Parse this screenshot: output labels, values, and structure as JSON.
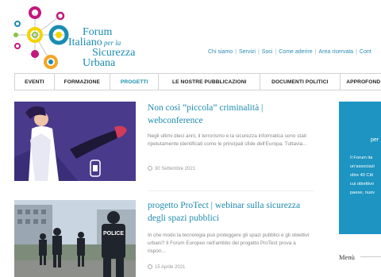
{
  "brand": {
    "line1": "Forum",
    "line2_main": "Italiano",
    "line2_small": " per la",
    "line3": "Sicurezza",
    "line4": "Urbana"
  },
  "colors": {
    "accent": "#1a8db0",
    "sidebar_bg": "#1d94c1",
    "logo_pink": "#c2187d",
    "logo_orange": "#f5a623",
    "logo_yellow": "#f2d400",
    "logo_green": "#8bc34a",
    "logo_blue": "#1a8db0"
  },
  "topnav": {
    "items": [
      "Chi siamo",
      "Servizi",
      "Soci",
      "Come aderire",
      "Area riservata",
      "Cont"
    ]
  },
  "mainnav": {
    "items": [
      "EVENTI",
      "FORMAZIONE",
      "PROGETTI",
      "LE NOSTRE PUBBLICAZIONI",
      "DOCUMENTI POLITICI",
      "APPROFOND"
    ],
    "active": "PROGETTI"
  },
  "articles": [
    {
      "title": "Non così “piccola” criminalità | webconference",
      "excerpt": "Negli ultimi dieci anni, il terrorismo e la sicurezza informatica sono stati ripetutamente identificati come le principali sfide dell'Europa. Tuttavia...",
      "date": "30 Settembre 2021"
    },
    {
      "title": "progetto ProTect | webinar sulla sicurezza degli spazi pubblici",
      "excerpt": "In che modo la tecnologia può proteggere gli spazi pubblici e gli obiettivi urbani? Il Forum Europeo nell'ambito del progetto ProTect prova a rispon...",
      "date": "15 Aprile 2021"
    }
  ],
  "thumb2": {
    "police_label": "POLICE"
  },
  "sidebar": {
    "box_title": "per",
    "box_lines": [
      "Il Forum ita",
      "un'associazi",
      "oltre 40 Citt",
      "cui obiettivo",
      "paese, nuov"
    ],
    "menu_title": "Menù"
  }
}
